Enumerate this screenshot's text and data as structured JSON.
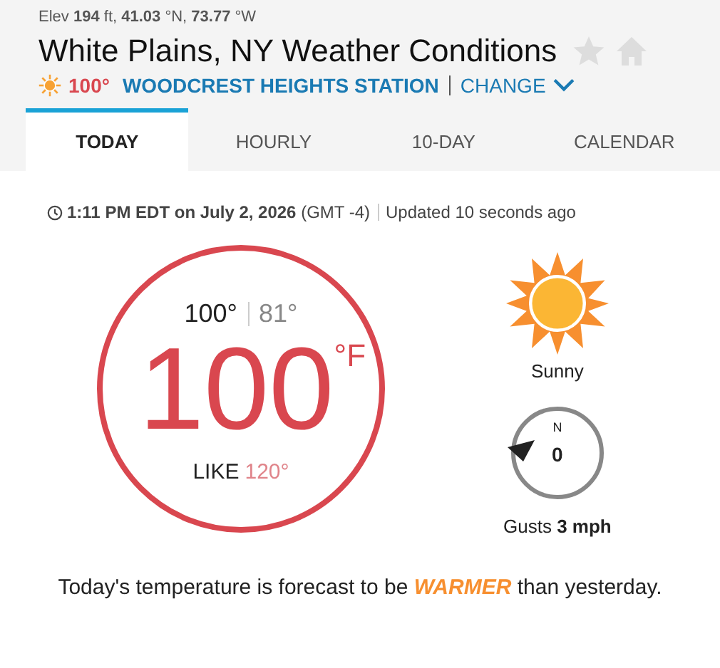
{
  "location": {
    "elevation": "Elev **194** ft, **41.03** °N, **73.77** °W",
    "title": "White Plains, NY Weather Conditions",
    "station_temp": "100°",
    "station": "WOODCREST HEIGHTS STATION",
    "change": "CHANGE"
  },
  "tabs": [
    {
      "label": "TODAY",
      "selected": true
    },
    {
      "label": "HOURLY",
      "selected": false
    },
    {
      "label": "10-DAY",
      "selected": false
    },
    {
      "label": "CALENDAR",
      "selected": false
    }
  ],
  "observation": {
    "time": "**1:11 PM EDT on July 2, 2026** (GMT -4)",
    "updated": "Updated 10 seconds ago"
  },
  "current": {
    "high": "100°",
    "low": "81°",
    "temperature": "100",
    "unit": "°F",
    "feels_label": "LIKE",
    "feels_value": "120°"
  },
  "condition": "Sunny",
  "wind": {
    "direction": "N",
    "speed": "0",
    "gusts": "Gusts **3 mph**"
  },
  "summary": "Today's temperature is forecast to be **WARMER** than yesterday."
}
